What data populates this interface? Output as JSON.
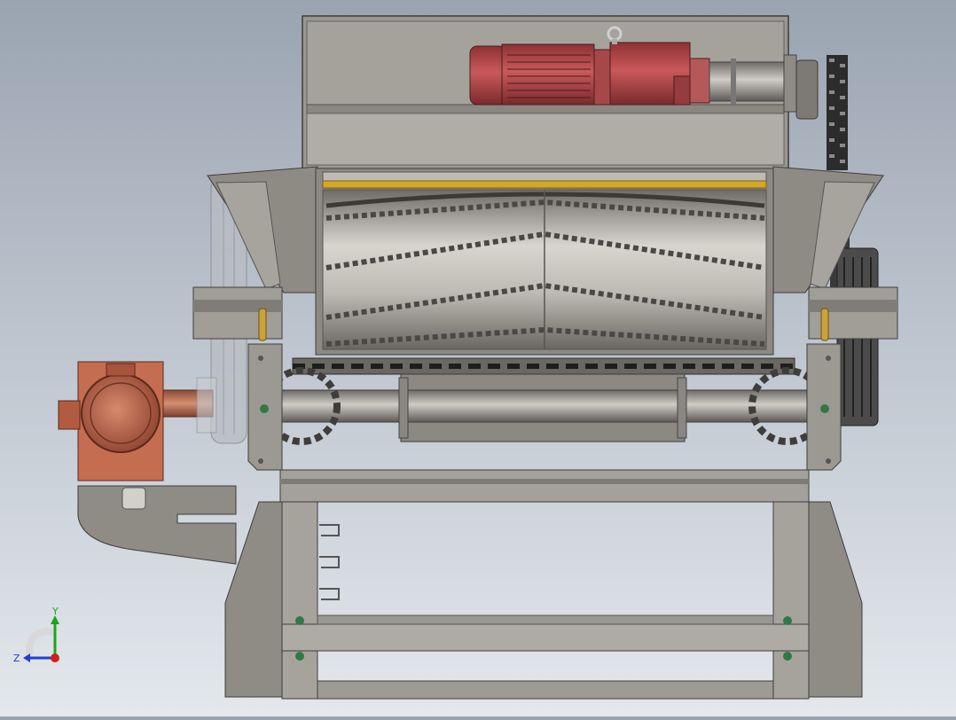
{
  "view": {
    "background_top": "#9aa4b1",
    "background_bottom": "#e4e8ec"
  },
  "model": {
    "frame_color": "#8f8c86",
    "frame_dark": "#5f5d59",
    "motor_color": "#b24a4c",
    "gearbox_color": "#c06a4f",
    "accent_yellow": "#d2a827",
    "rotor_color": "#a9a6a0",
    "bolt_color": "#2f7a43"
  },
  "triad": {
    "y_label": "Y",
    "z_label": "Z",
    "y_color": "#1aa51a",
    "z_color": "#1f3fd1",
    "x_color": "#d11f1f"
  }
}
